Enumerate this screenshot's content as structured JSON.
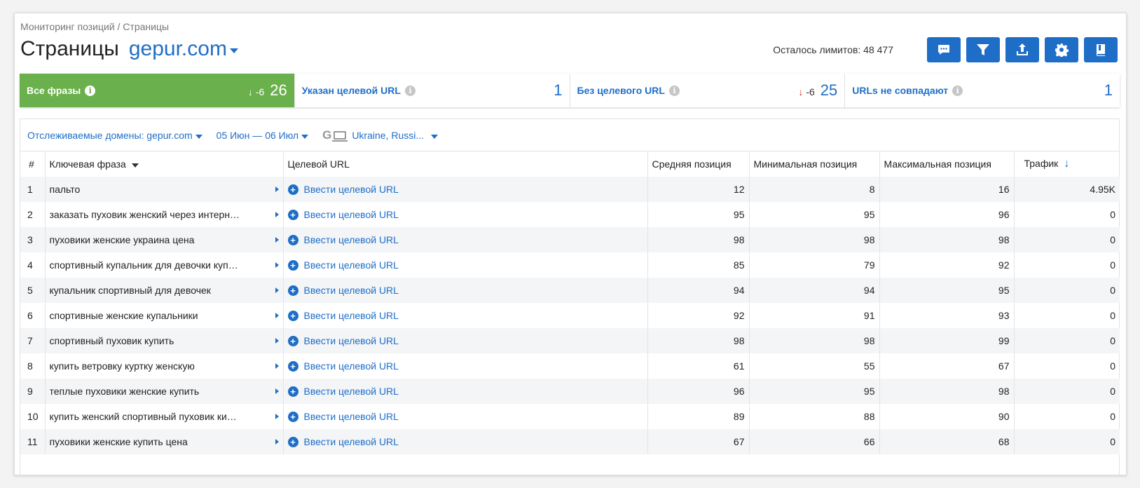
{
  "breadcrumb": "Мониторинг позиций / Страницы",
  "page_title": "Страницы",
  "domain": "gepur.com",
  "limits": "Осталось лимитов: 48 477",
  "toolbar": {
    "buttons": [
      "comment-icon",
      "filter-icon",
      "export-icon",
      "gear-icon",
      "book-icon"
    ]
  },
  "stats": [
    {
      "label": "Все фразы",
      "delta": "-6",
      "delta_arrow": "↓",
      "value": "26"
    },
    {
      "label": "Указан целевой URL",
      "value": "1"
    },
    {
      "label": "Без целевого URL",
      "delta": "-6",
      "delta_arrow": "↓",
      "value": "25"
    },
    {
      "label": "URLs не совпадают",
      "value": "1"
    }
  ],
  "filters": {
    "domains": "Отслеживаемые домены: gepur.com",
    "dates": "05 Июн — 06 Июл",
    "engine_letter": "G",
    "region": "Ukraine, Russi..."
  },
  "table": {
    "headers": [
      "#",
      "Ключевая фраза",
      "Целевой URL",
      "Средняя позиция",
      "Минимальная позиция",
      "Максимальная позиция",
      "Трафик"
    ],
    "link_label": "Ввести целевой URL",
    "rows": [
      {
        "n": "1",
        "kw": "пальто",
        "avg": "12",
        "min": "8",
        "max": "16",
        "traffic": "4.95K"
      },
      {
        "n": "2",
        "kw": "заказать пуховик женский через интерн…",
        "avg": "95",
        "min": "95",
        "max": "96",
        "traffic": "0"
      },
      {
        "n": "3",
        "kw": "пуховики женские украина цена",
        "avg": "98",
        "min": "98",
        "max": "98",
        "traffic": "0"
      },
      {
        "n": "4",
        "kw": "спортивный купальник для девочки куп…",
        "avg": "85",
        "min": "79",
        "max": "92",
        "traffic": "0"
      },
      {
        "n": "5",
        "kw": "купальник спортивный для девочек",
        "avg": "94",
        "min": "94",
        "max": "95",
        "traffic": "0"
      },
      {
        "n": "6",
        "kw": "спортивные женские купальники",
        "avg": "92",
        "min": "91",
        "max": "93",
        "traffic": "0"
      },
      {
        "n": "7",
        "kw": "спортивный пуховик купить",
        "avg": "98",
        "min": "98",
        "max": "99",
        "traffic": "0"
      },
      {
        "n": "8",
        "kw": "купить ветровку куртку женскую",
        "avg": "61",
        "min": "55",
        "max": "67",
        "traffic": "0"
      },
      {
        "n": "9",
        "kw": "теплые пуховики женские купить",
        "avg": "96",
        "min": "95",
        "max": "98",
        "traffic": "0"
      },
      {
        "n": "10",
        "kw": "купить женский спортивный пуховик ки…",
        "avg": "89",
        "min": "88",
        "max": "90",
        "traffic": "0"
      },
      {
        "n": "11",
        "kw": "пуховики женские купить цена",
        "avg": "67",
        "min": "66",
        "max": "68",
        "traffic": "0"
      }
    ]
  },
  "colors": {
    "accent": "#1e6ec8",
    "active_stat": "#6ab04c",
    "down_red": "#d33"
  }
}
